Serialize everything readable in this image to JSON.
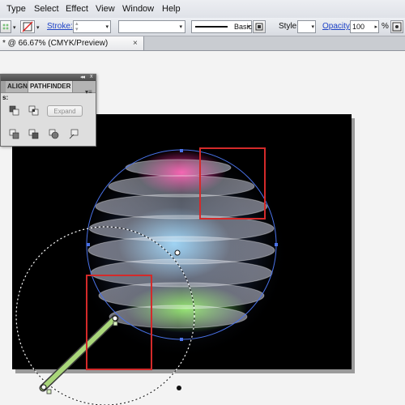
{
  "menu": {
    "items": [
      "Type",
      "Select",
      "Effect",
      "View",
      "Window",
      "Help"
    ]
  },
  "controlbar": {
    "stroke_label": "Stroke:",
    "brush_label": "Basic",
    "style_label": "Style:",
    "opacity_label": "Opacity:",
    "opacity_value": "100",
    "percent_sign": "%"
  },
  "document": {
    "tab_title": "* @ 66.67% (CMYK/Preview)",
    "close_glyph": "×"
  },
  "pathfinder": {
    "tab_align": "ALIGN",
    "tab_pathfinder": "PATHFINDER",
    "section_label": "s:",
    "expand_button": "Expand",
    "collapse_glyph": "◂◂",
    "close_glyph": "x",
    "menu_glyph": "▾≡"
  },
  "colors": {
    "highlight_red": "#d42a2a",
    "selection_blue": "#4a72e8",
    "tool_green": "#a9d67a",
    "link_blue": "#1f44c8"
  }
}
